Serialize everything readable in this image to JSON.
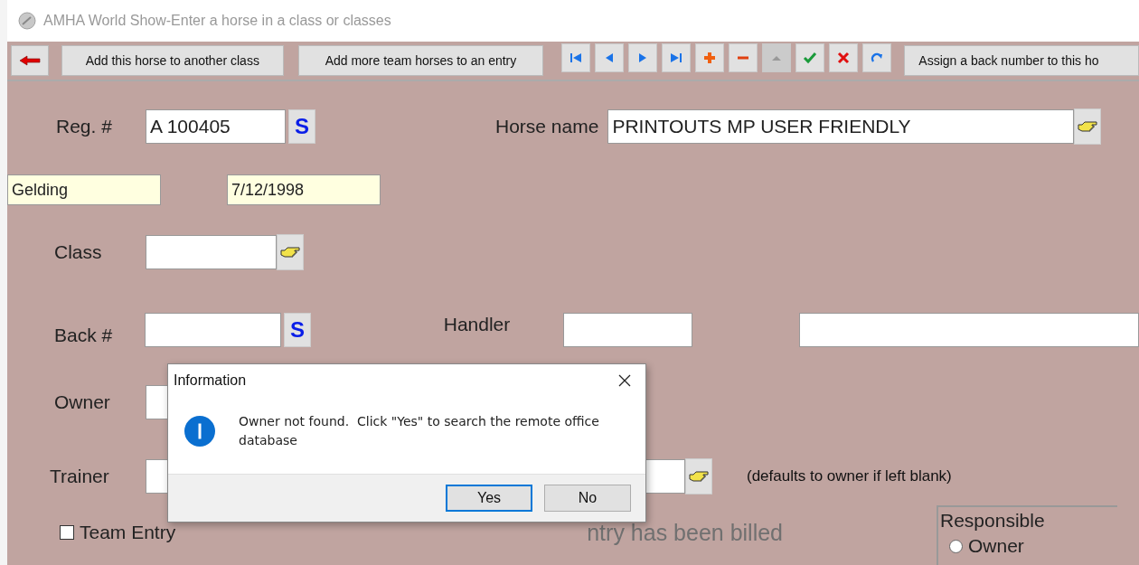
{
  "window": {
    "title": "AMHA World Show-Enter a horse in a class or classes"
  },
  "toolbar": {
    "buttons": [
      {
        "label": "Add this horse to another class"
      },
      {
        "label": "Add more team horses to an entry"
      }
    ],
    "nav_buttons": [
      {
        "kind": "first",
        "disabled": false
      },
      {
        "kind": "prev",
        "disabled": false
      },
      {
        "kind": "next",
        "disabled": false
      },
      {
        "kind": "last",
        "disabled": false
      },
      {
        "kind": "add",
        "disabled": false
      },
      {
        "kind": "remove",
        "disabled": false
      },
      {
        "kind": "up",
        "disabled": true
      },
      {
        "kind": "ok",
        "disabled": false
      },
      {
        "kind": "cancel",
        "disabled": false
      },
      {
        "kind": "refresh",
        "disabled": false
      }
    ],
    "assign_button": {
      "label": "Assign a back number to this ho"
    }
  },
  "form": {
    "reg": {
      "label": "Reg. #",
      "value": "A 100405",
      "search": "S"
    },
    "horse_name": {
      "label": "Horse name",
      "value": "PRINTOUTS MP USER FRIENDLY"
    },
    "sex": {
      "value": "Gelding"
    },
    "birth_date": {
      "value": "7/12/1998"
    },
    "class": {
      "label": "Class"
    },
    "back_number": {
      "label": "Back #",
      "search": "S"
    },
    "handler": {
      "label": "Handler"
    },
    "owner": {
      "label": "Owner"
    },
    "trainer": {
      "label": "Trainer",
      "note": "(defaults to owner if left blank)"
    },
    "team_entry": {
      "label": "Team Entry",
      "checked": false
    },
    "billed": {
      "text": "ntry has been billed",
      "disabled": true
    },
    "responsible": {
      "title": "Responsible",
      "options": [
        {
          "label": "Owner",
          "selected": false
        }
      ]
    }
  },
  "dialog": {
    "title": "Information",
    "message": "Owner not found.  Click \"Yes\" to search the remote office database",
    "buttons": [
      {
        "label": "Yes",
        "default": true
      },
      {
        "label": "No",
        "default": false
      }
    ]
  }
}
